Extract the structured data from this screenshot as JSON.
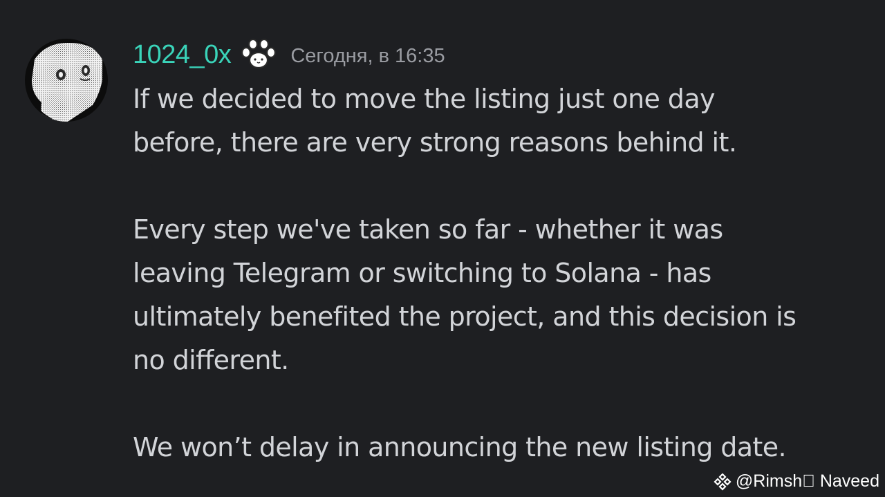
{
  "message": {
    "author": "1024_0x",
    "timestamp": "Сегодня, в 16:35",
    "badge_icon": "paw-icon",
    "paragraphs": [
      "If we decided to move the listing just one day\nbefore, there are very strong reasons behind it.",
      "Every step we've taken so far - whether it was\nleaving Telegram or switching to Solana - has\nultimately benefited the project, and this decision is\nno different.",
      "We won’t delay in announcing the new listing date."
    ]
  },
  "watermark": {
    "icon": "binance-diamond-icon",
    "text": "@Rimsh\u0000 Naveed"
  },
  "colors": {
    "background": "#1e1f22",
    "username": "#3ad3b9",
    "timestamp": "#9a9ca2",
    "text": "#d2d4d8"
  }
}
